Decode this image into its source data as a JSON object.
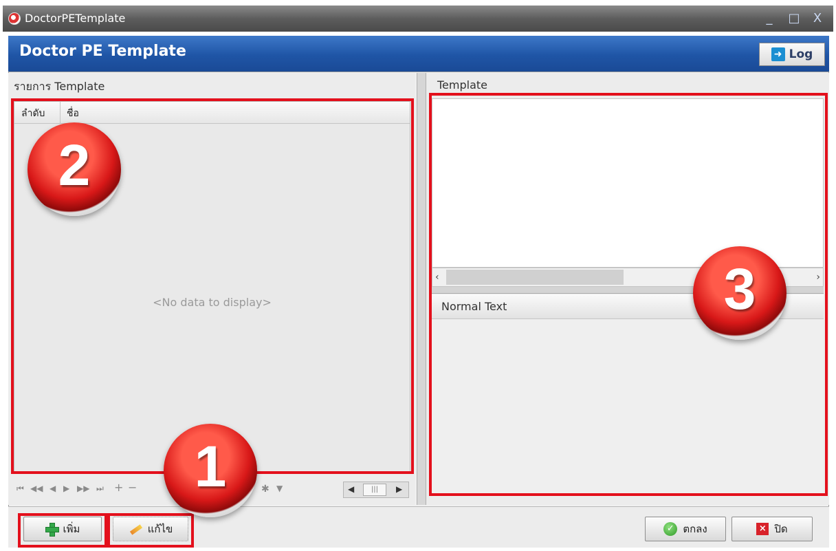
{
  "window": {
    "title": "DoctorPETemplate",
    "minimize": "_",
    "maximize": "□",
    "close": "X"
  },
  "header": {
    "title": "Doctor PE Template",
    "log_label": "Log"
  },
  "left_panel": {
    "caption": "รายการ Template",
    "columns": [
      "ลำดับ",
      "ชื่อ"
    ],
    "empty_text": "<No data to display>"
  },
  "right_panel": {
    "template_caption": "Template",
    "normal_text_caption": "Normal Text"
  },
  "buttons": {
    "add": "เพิ่ม",
    "edit": "แก้ไข",
    "ok": "ตกลง",
    "close": "ปิด"
  },
  "annotations": [
    "1",
    "2",
    "3"
  ],
  "colors": {
    "header_blue": "#2a5fb0",
    "annotation_red": "#e3101c"
  }
}
